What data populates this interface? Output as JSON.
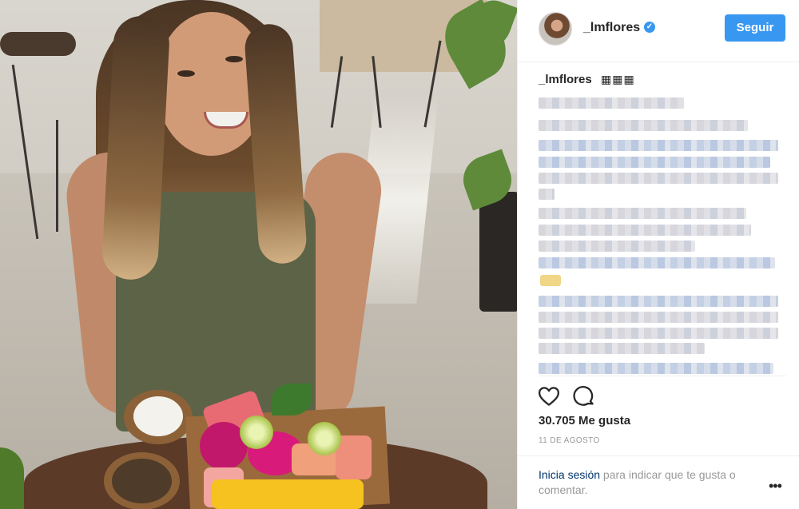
{
  "header": {
    "username": "_lmflores",
    "verified_badge": "✓",
    "follow_button": "Seguir"
  },
  "caption": {
    "username": "_lmflores",
    "emoji": "▦▦▦"
  },
  "actions": {
    "like_icon": "heart-icon",
    "comment_icon": "comment-icon"
  },
  "likes": "30.705 Me gusta",
  "date": "11 DE AGOSTO",
  "footer": {
    "login_link": "Inicia sesión",
    "login_text": " para indicar que te gusta o comentar.",
    "more": "•••"
  },
  "colors": {
    "accent": "#3897f0",
    "link": "#003569",
    "muted": "#999999"
  }
}
